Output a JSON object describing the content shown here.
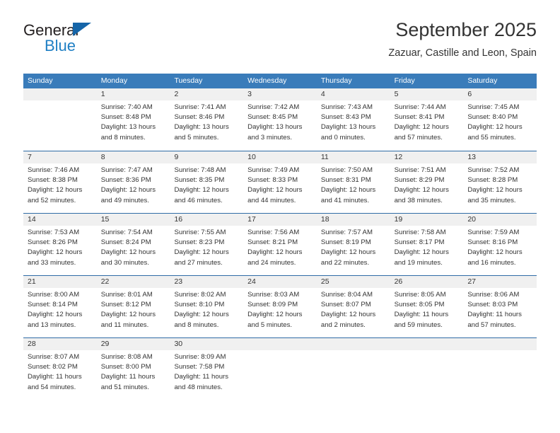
{
  "brand": {
    "name_part1": "General",
    "name_part2": "Blue",
    "triangle_color": "#1565a8",
    "blue_color": "#1f7fc4"
  },
  "header": {
    "title": "September 2025",
    "subtitle": "Zazuar, Castille and Leon, Spain"
  },
  "theme": {
    "header_row_bg": "#3a7cba",
    "header_row_text": "#ffffff",
    "daynum_band_bg": "#f0f0f0",
    "week_divider": "#2f6ca6",
    "body_text": "#333333"
  },
  "weekdays": [
    "Sunday",
    "Monday",
    "Tuesday",
    "Wednesday",
    "Thursday",
    "Friday",
    "Saturday"
  ],
  "weeks": [
    [
      {
        "day": "",
        "lines": []
      },
      {
        "day": "1",
        "lines": [
          "Sunrise: 7:40 AM",
          "Sunset: 8:48 PM",
          "Daylight: 13 hours",
          "and 8 minutes."
        ]
      },
      {
        "day": "2",
        "lines": [
          "Sunrise: 7:41 AM",
          "Sunset: 8:46 PM",
          "Daylight: 13 hours",
          "and 5 minutes."
        ]
      },
      {
        "day": "3",
        "lines": [
          "Sunrise: 7:42 AM",
          "Sunset: 8:45 PM",
          "Daylight: 13 hours",
          "and 3 minutes."
        ]
      },
      {
        "day": "4",
        "lines": [
          "Sunrise: 7:43 AM",
          "Sunset: 8:43 PM",
          "Daylight: 13 hours",
          "and 0 minutes."
        ]
      },
      {
        "day": "5",
        "lines": [
          "Sunrise: 7:44 AM",
          "Sunset: 8:41 PM",
          "Daylight: 12 hours",
          "and 57 minutes."
        ]
      },
      {
        "day": "6",
        "lines": [
          "Sunrise: 7:45 AM",
          "Sunset: 8:40 PM",
          "Daylight: 12 hours",
          "and 55 minutes."
        ]
      }
    ],
    [
      {
        "day": "7",
        "lines": [
          "Sunrise: 7:46 AM",
          "Sunset: 8:38 PM",
          "Daylight: 12 hours",
          "and 52 minutes."
        ]
      },
      {
        "day": "8",
        "lines": [
          "Sunrise: 7:47 AM",
          "Sunset: 8:36 PM",
          "Daylight: 12 hours",
          "and 49 minutes."
        ]
      },
      {
        "day": "9",
        "lines": [
          "Sunrise: 7:48 AM",
          "Sunset: 8:35 PM",
          "Daylight: 12 hours",
          "and 46 minutes."
        ]
      },
      {
        "day": "10",
        "lines": [
          "Sunrise: 7:49 AM",
          "Sunset: 8:33 PM",
          "Daylight: 12 hours",
          "and 44 minutes."
        ]
      },
      {
        "day": "11",
        "lines": [
          "Sunrise: 7:50 AM",
          "Sunset: 8:31 PM",
          "Daylight: 12 hours",
          "and 41 minutes."
        ]
      },
      {
        "day": "12",
        "lines": [
          "Sunrise: 7:51 AM",
          "Sunset: 8:29 PM",
          "Daylight: 12 hours",
          "and 38 minutes."
        ]
      },
      {
        "day": "13",
        "lines": [
          "Sunrise: 7:52 AM",
          "Sunset: 8:28 PM",
          "Daylight: 12 hours",
          "and 35 minutes."
        ]
      }
    ],
    [
      {
        "day": "14",
        "lines": [
          "Sunrise: 7:53 AM",
          "Sunset: 8:26 PM",
          "Daylight: 12 hours",
          "and 33 minutes."
        ]
      },
      {
        "day": "15",
        "lines": [
          "Sunrise: 7:54 AM",
          "Sunset: 8:24 PM",
          "Daylight: 12 hours",
          "and 30 minutes."
        ]
      },
      {
        "day": "16",
        "lines": [
          "Sunrise: 7:55 AM",
          "Sunset: 8:23 PM",
          "Daylight: 12 hours",
          "and 27 minutes."
        ]
      },
      {
        "day": "17",
        "lines": [
          "Sunrise: 7:56 AM",
          "Sunset: 8:21 PM",
          "Daylight: 12 hours",
          "and 24 minutes."
        ]
      },
      {
        "day": "18",
        "lines": [
          "Sunrise: 7:57 AM",
          "Sunset: 8:19 PM",
          "Daylight: 12 hours",
          "and 22 minutes."
        ]
      },
      {
        "day": "19",
        "lines": [
          "Sunrise: 7:58 AM",
          "Sunset: 8:17 PM",
          "Daylight: 12 hours",
          "and 19 minutes."
        ]
      },
      {
        "day": "20",
        "lines": [
          "Sunrise: 7:59 AM",
          "Sunset: 8:16 PM",
          "Daylight: 12 hours",
          "and 16 minutes."
        ]
      }
    ],
    [
      {
        "day": "21",
        "lines": [
          "Sunrise: 8:00 AM",
          "Sunset: 8:14 PM",
          "Daylight: 12 hours",
          "and 13 minutes."
        ]
      },
      {
        "day": "22",
        "lines": [
          "Sunrise: 8:01 AM",
          "Sunset: 8:12 PM",
          "Daylight: 12 hours",
          "and 11 minutes."
        ]
      },
      {
        "day": "23",
        "lines": [
          "Sunrise: 8:02 AM",
          "Sunset: 8:10 PM",
          "Daylight: 12 hours",
          "and 8 minutes."
        ]
      },
      {
        "day": "24",
        "lines": [
          "Sunrise: 8:03 AM",
          "Sunset: 8:09 PM",
          "Daylight: 12 hours",
          "and 5 minutes."
        ]
      },
      {
        "day": "25",
        "lines": [
          "Sunrise: 8:04 AM",
          "Sunset: 8:07 PM",
          "Daylight: 12 hours",
          "and 2 minutes."
        ]
      },
      {
        "day": "26",
        "lines": [
          "Sunrise: 8:05 AM",
          "Sunset: 8:05 PM",
          "Daylight: 11 hours",
          "and 59 minutes."
        ]
      },
      {
        "day": "27",
        "lines": [
          "Sunrise: 8:06 AM",
          "Sunset: 8:03 PM",
          "Daylight: 11 hours",
          "and 57 minutes."
        ]
      }
    ],
    [
      {
        "day": "28",
        "lines": [
          "Sunrise: 8:07 AM",
          "Sunset: 8:02 PM",
          "Daylight: 11 hours",
          "and 54 minutes."
        ]
      },
      {
        "day": "29",
        "lines": [
          "Sunrise: 8:08 AM",
          "Sunset: 8:00 PM",
          "Daylight: 11 hours",
          "and 51 minutes."
        ]
      },
      {
        "day": "30",
        "lines": [
          "Sunrise: 8:09 AM",
          "Sunset: 7:58 PM",
          "Daylight: 11 hours",
          "and 48 minutes."
        ]
      },
      {
        "day": "",
        "lines": []
      },
      {
        "day": "",
        "lines": []
      },
      {
        "day": "",
        "lines": []
      },
      {
        "day": "",
        "lines": []
      }
    ]
  ]
}
